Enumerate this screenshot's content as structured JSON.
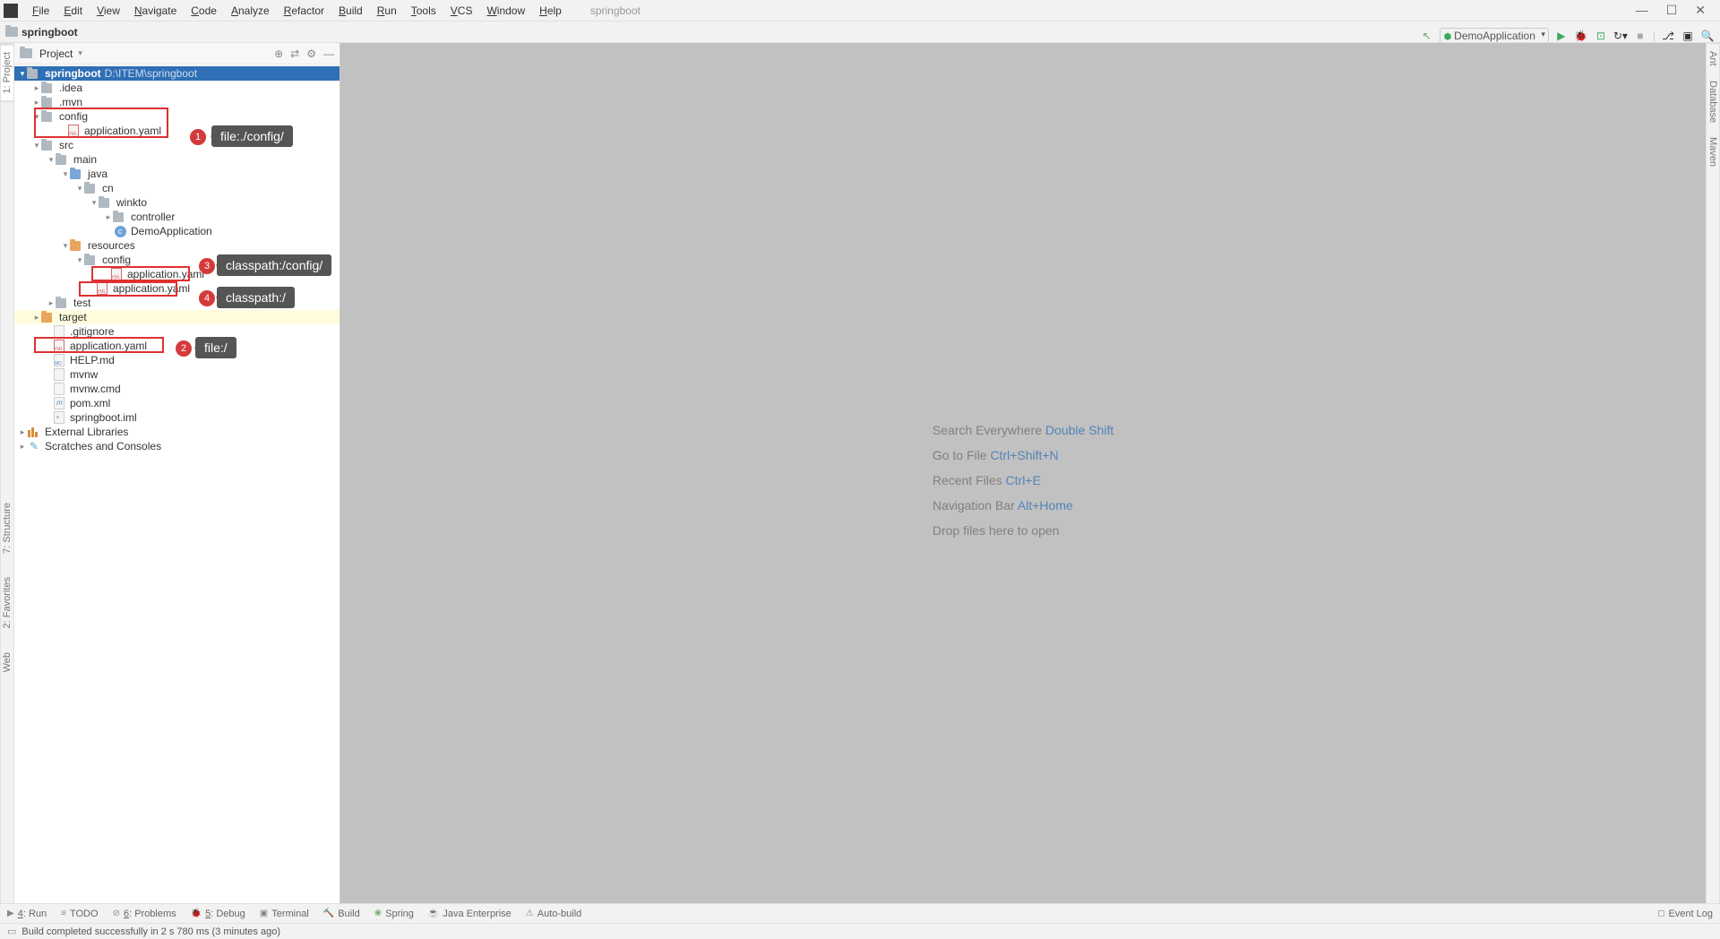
{
  "menubar": {
    "menus": [
      "File",
      "Edit",
      "View",
      "Navigate",
      "Code",
      "Analyze",
      "Refactor",
      "Build",
      "Run",
      "Tools",
      "VCS",
      "Window",
      "Help"
    ],
    "project_hint": "springboot"
  },
  "breadcrumb": {
    "project": "springboot"
  },
  "toolbar": {
    "run_config": "DemoApplication"
  },
  "left_gutter": {
    "project": "1: Project",
    "structure": "7: Structure",
    "favorites": "2: Favorites",
    "web": "Web"
  },
  "right_gutter": {
    "ant": "Ant",
    "database": "Database",
    "maven": "Maven"
  },
  "panel": {
    "title": "Project"
  },
  "tree": {
    "root_name": "springboot",
    "root_path": "D:\\ITEM\\springboot",
    "idea": ".idea",
    "mvn": ".mvn",
    "config": "config",
    "config_app": "application.yaml",
    "src": "src",
    "main": "main",
    "java": "java",
    "cn": "cn",
    "winkto": "winkto",
    "controller": "controller",
    "demoapp": "DemoApplication",
    "resources": "resources",
    "res_config": "config",
    "res_config_app": "application.yaml",
    "res_app": "application.yaml",
    "test": "test",
    "target": "target",
    "gitignore": ".gitignore",
    "root_app": "application.yaml",
    "helpmd": "HELP.md",
    "mvnw": "mvnw",
    "mvnwcmd": "mvnw.cmd",
    "pom": "pom.xml",
    "iml": "springboot.iml",
    "extlib": "External Libraries",
    "scratches": "Scratches and Consoles"
  },
  "annotations": {
    "b1": "1",
    "l1": "file:./config/",
    "b2": "2",
    "l2": "file:/",
    "b3": "3",
    "l3": "classpath:/config/",
    "b4": "4",
    "l4": "classpath:/"
  },
  "welcome": {
    "search": "Search Everywhere ",
    "search_k": "Double Shift",
    "goto": "Go to File ",
    "goto_k": "Ctrl+Shift+N",
    "recent": "Recent Files ",
    "recent_k": "Ctrl+E",
    "nav": "Navigation Bar ",
    "nav_k": "Alt+Home",
    "drop": "Drop files here to open"
  },
  "bottom_tabs": {
    "run": "4: Run",
    "todo": "TODO",
    "problems": "6: Problems",
    "debug": "5: Debug",
    "terminal": "Terminal",
    "build": "Build",
    "spring": "Spring",
    "javaee": "Java Enterprise",
    "autobuild": "Auto-build",
    "eventlog": "Event Log"
  },
  "status": {
    "message": "Build completed successfully in 2 s 780 ms (3 minutes ago)"
  }
}
